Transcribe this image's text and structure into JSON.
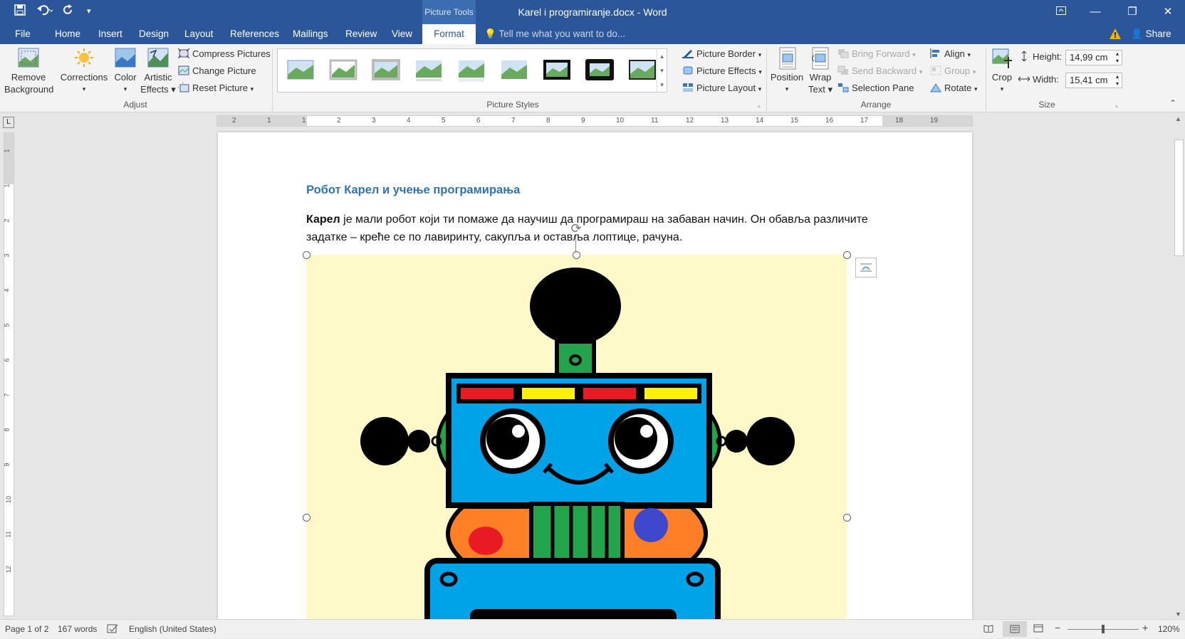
{
  "titlebar": {
    "context_label": "Picture Tools",
    "title": "Karel i programiranje.docx - Word"
  },
  "tabs": [
    "File",
    "Home",
    "Insert",
    "Design",
    "Layout",
    "References",
    "Mailings",
    "Review",
    "View",
    "Format"
  ],
  "active_tab": "Format",
  "tellme_placeholder": "Tell me what you want to do...",
  "share_label": "Share",
  "ribbon": {
    "adjust": {
      "remove_background": [
        "Remove",
        "Background"
      ],
      "corrections": "Corrections",
      "color": "Color",
      "artistic_effects": [
        "Artistic",
        "Effects"
      ],
      "compress": "Compress Pictures",
      "change": "Change Picture",
      "reset": "Reset Picture",
      "group_label": "Adjust"
    },
    "styles": {
      "picture_border": "Picture Border",
      "picture_effects": "Picture Effects",
      "picture_layout": "Picture Layout",
      "group_label": "Picture Styles"
    },
    "arrange": {
      "position": "Position",
      "wrap_text": [
        "Wrap",
        "Text"
      ],
      "bring_forward": "Bring Forward",
      "send_backward": "Send Backward",
      "selection_pane": "Selection Pane",
      "align": "Align",
      "group": "Group",
      "rotate": "Rotate",
      "group_label": "Arrange"
    },
    "size": {
      "crop": "Crop",
      "height_label": "Height:",
      "height_value": "14,99 cm",
      "width_label": "Width:",
      "width_value": "15,41 cm",
      "group_label": "Size"
    }
  },
  "ruler": {
    "h_ticks": [
      "2",
      "1",
      "1",
      "2",
      "3",
      "4",
      "5",
      "6",
      "7",
      "8",
      "9",
      "10",
      "11",
      "12",
      "13",
      "14",
      "15",
      "16",
      "17",
      "18",
      "19"
    ],
    "v_ticks": [
      "1",
      "1",
      "2",
      "3",
      "4",
      "5",
      "6",
      "7",
      "8",
      "9",
      "10",
      "11",
      "12"
    ]
  },
  "document": {
    "heading": "Робот Карел и учење програмирања",
    "para_bold": "Карел",
    "para_rest": " је мали робот који ти помаже да научиш да програмираш на забаван начин. Он обавља различите задатке – креће се по лавиринту, сакупља и оставља лоптице, рачуна."
  },
  "status": {
    "page": "Page 1 of 2",
    "words": "167 words",
    "language": "English (United States)",
    "zoom": "120%"
  },
  "colors": {
    "brand": "#2b579a",
    "heading": "#2e74b5",
    "picture_bg": "#fff9c9"
  }
}
